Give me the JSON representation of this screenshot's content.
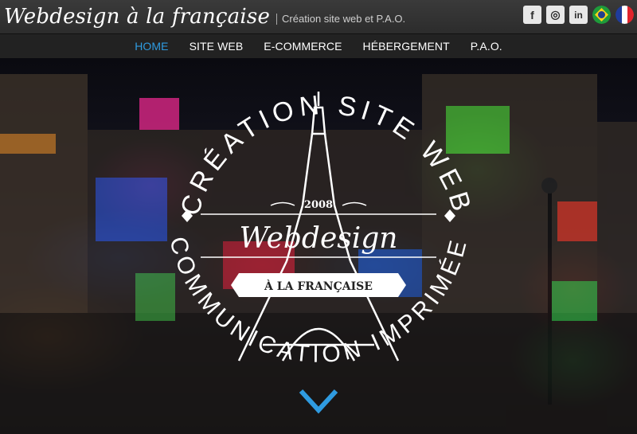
{
  "header": {
    "brand": "Webdesign à la française",
    "tagline": "Création site web et P.A.O."
  },
  "social": [
    {
      "name": "facebook-icon",
      "glyph": "f"
    },
    {
      "name": "instagram-icon",
      "glyph": "◎"
    },
    {
      "name": "linkedin-icon",
      "glyph": "in"
    }
  ],
  "languages": [
    {
      "name": "flag-brazil-icon"
    },
    {
      "name": "flag-france-icon"
    }
  ],
  "nav": {
    "items": [
      "HOME",
      "SITE WEB",
      "E-COMMERCE",
      "HÉBERGEMENT",
      "P.A.O."
    ],
    "active_index": 0,
    "active_color": "#2f9be0"
  },
  "hero": {
    "arc_top": "CRÉATION SITE WEB",
    "arc_bottom": "COMMUNICATION IMPRIMÉE",
    "year": "2008",
    "logo_word": "Webdesign",
    "banner": "À LA FRANÇAISE",
    "scroll_icon": "chevron-down-icon",
    "scroll_color": "#2f9be0"
  }
}
